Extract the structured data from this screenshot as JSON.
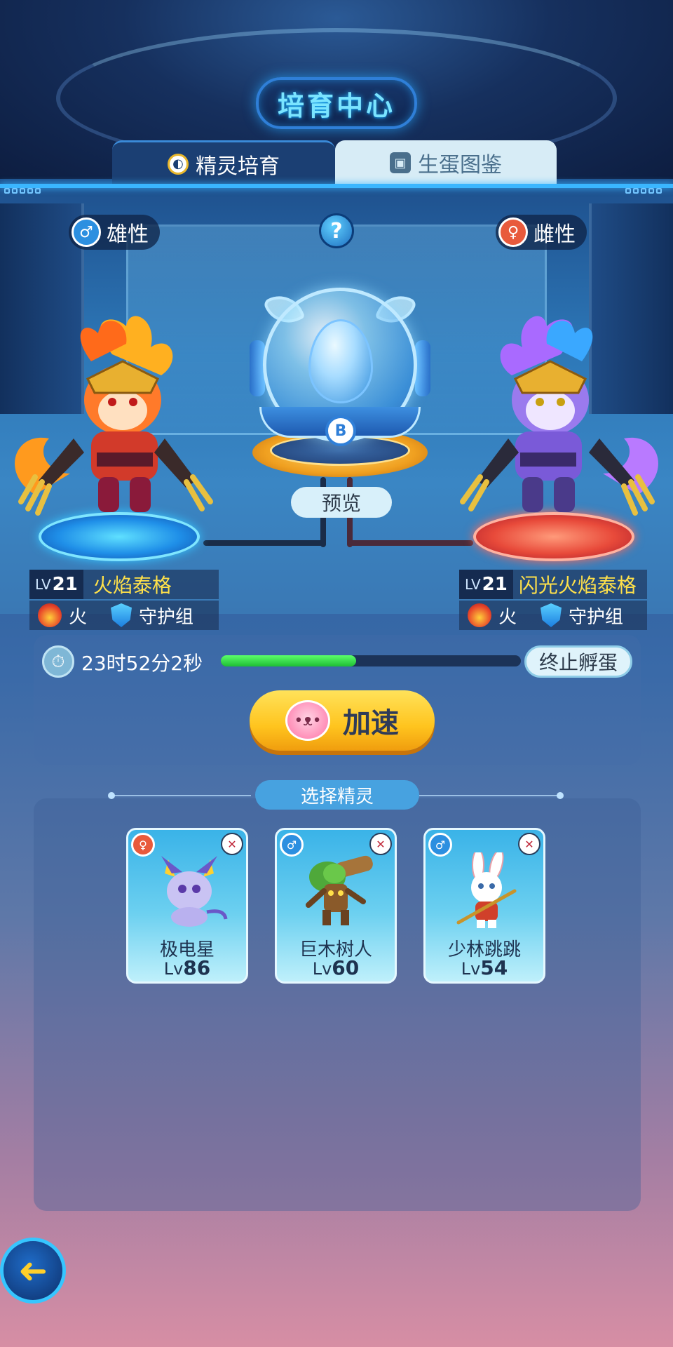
{
  "title": "培育中心",
  "tabs": [
    {
      "label": "精灵培育",
      "active": true,
      "icon": "breed-icon"
    },
    {
      "label": "生蛋图鉴",
      "active": false,
      "icon": "book-icon"
    }
  ],
  "parents": {
    "male": {
      "gender_label": "雄性",
      "level_prefix": "LV",
      "level": "21",
      "name": "火焰泰格",
      "attribute": "火",
      "group": "守护组"
    },
    "female": {
      "gender_label": "雌性",
      "level_prefix": "LV",
      "level": "21",
      "name": "闪光火焰泰格",
      "attribute": "火",
      "group": "守护组"
    }
  },
  "help_label": "?",
  "incubator": {
    "badge": "B",
    "preview_label": "预览"
  },
  "hatch": {
    "time_remaining": "23时52分2秒",
    "progress": 0.45,
    "stop_label": "终止孵蛋",
    "speed_label": "加速"
  },
  "selection": {
    "title": "选择精灵",
    "cards": [
      {
        "name": "极电星",
        "level_prefix": "Lv",
        "level": "86",
        "gender": "female"
      },
      {
        "name": "巨木树人",
        "level_prefix": "Lv",
        "level": "60",
        "gender": "male"
      },
      {
        "name": "少林跳跳",
        "level_prefix": "Lv",
        "level": "54",
        "gender": "male"
      }
    ]
  },
  "colors": {
    "accent": "#3ab6ff",
    "title_glow": "#7ae4ff",
    "name_yellow": "#ffe14a",
    "speed_button": "#ffc41e",
    "progress_green": "#1ebd34",
    "male_blue": "#2c8fe0",
    "female_red": "#e85a3c"
  }
}
